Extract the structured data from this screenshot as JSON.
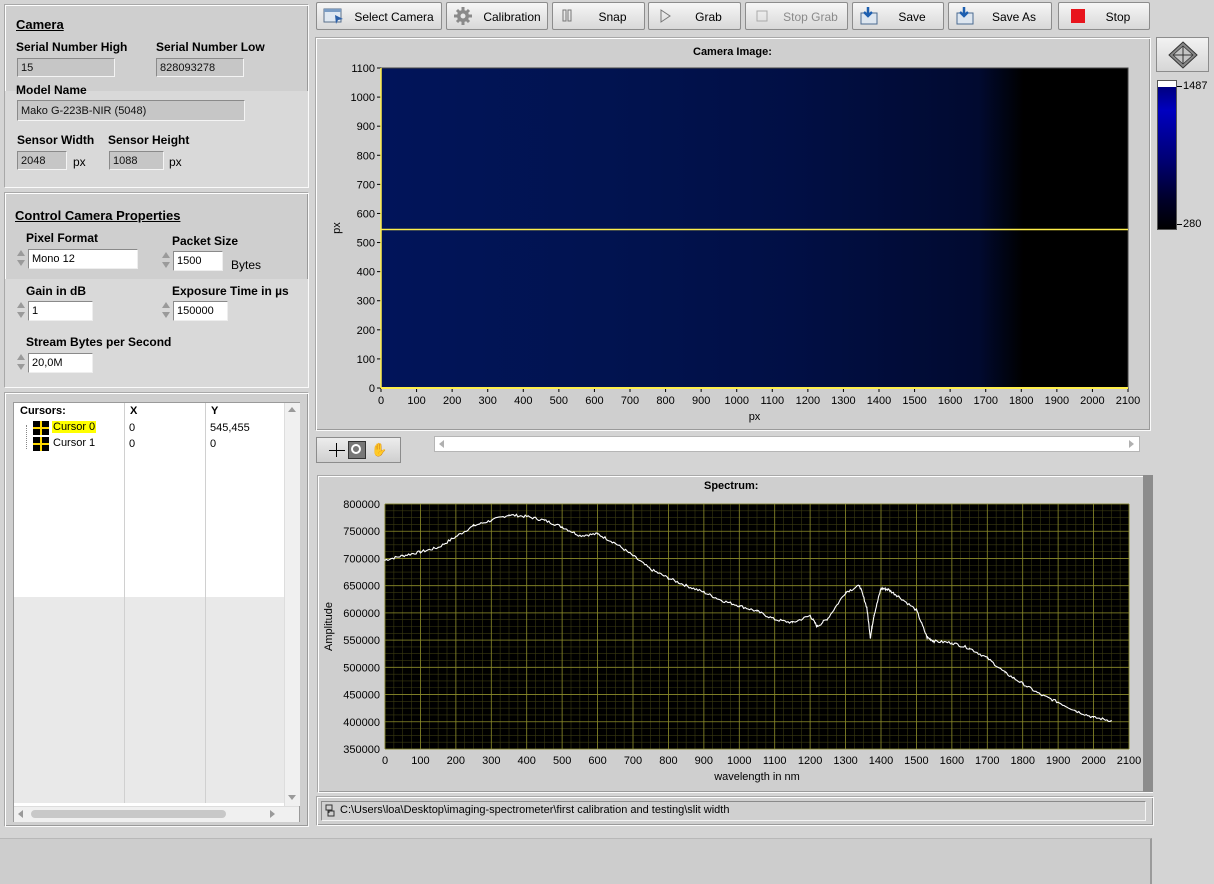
{
  "toolbar": {
    "select_camera": "Select Camera",
    "calibration": "Calibration",
    "snap": "Snap",
    "grab": "Grab",
    "stop_grab": "Stop Grab",
    "save": "Save",
    "save_as": "Save As",
    "stop": "Stop"
  },
  "camera": {
    "heading": "Camera",
    "serial_high_label": "Serial Number High",
    "serial_high": "15",
    "serial_low_label": "Serial Number Low",
    "serial_low": "828093278",
    "model_label": "Model Name",
    "model": "Mako G-223B-NIR (5048)",
    "width_label": "Sensor Width",
    "width": "2048",
    "height_label": "Sensor Height",
    "height": "1088",
    "unit_px": "px"
  },
  "control": {
    "heading": "Control Camera Properties",
    "pixel_format_label": "Pixel Format",
    "pixel_format": "Mono 12",
    "packet_size_label": "Packet Size",
    "packet_size": "1500",
    "bytes_unit": "Bytes",
    "gain_label": "Gain in dB",
    "gain": "1",
    "exposure_label": "Exposure Time in µs",
    "exposure": "150000",
    "stream_label": "Stream Bytes per Second",
    "stream": "20,0M"
  },
  "cursors": {
    "col_name": "Cursors:",
    "col_x": "X",
    "col_y": "Y",
    "rows": [
      {
        "name": "Cursor 0",
        "x": "0",
        "y": "545,455"
      },
      {
        "name": "Cursor 1",
        "x": "0",
        "y": "0"
      }
    ]
  },
  "image": {
    "title": "Camera Image:",
    "xlabel": "px",
    "ylabel": "px",
    "cursor_y": 545,
    "x_ticks": [
      "0",
      "100",
      "200",
      "300",
      "400",
      "500",
      "600",
      "700",
      "800",
      "900",
      "1000",
      "1100",
      "1200",
      "1300",
      "1400",
      "1500",
      "1600",
      "1700",
      "1800",
      "1900",
      "2000",
      "2100"
    ],
    "y_ticks": [
      "1100",
      "1000",
      "900",
      "800",
      "700",
      "600",
      "500",
      "400",
      "300",
      "200",
      "100",
      "0"
    ],
    "colorbar_max": "1487",
    "colorbar_min": "280"
  },
  "chart_data": {
    "type": "line",
    "title": "Spectrum:",
    "xlabel": "wavelength in nm",
    "ylabel": "Amplitude",
    "xlim": [
      0,
      2100
    ],
    "ylim": [
      350000,
      800000
    ],
    "x_ticks": [
      "0",
      "100",
      "200",
      "300",
      "400",
      "500",
      "600",
      "700",
      "800",
      "900",
      "1000",
      "1100",
      "1200",
      "1300",
      "1400",
      "1500",
      "1600",
      "1700",
      "1800",
      "1900",
      "2000",
      "2100"
    ],
    "y_ticks": [
      "800000",
      "750000",
      "700000",
      "650000",
      "600000",
      "550000",
      "500000",
      "450000",
      "400000",
      "350000"
    ],
    "series": [
      {
        "x": [
          0,
          50,
          100,
          150,
          200,
          250,
          300,
          350,
          400,
          450,
          500,
          550,
          600,
          650,
          700,
          750,
          800,
          850,
          900,
          950,
          1000,
          1050,
          1100,
          1150,
          1200,
          1220,
          1250,
          1300,
          1340,
          1360,
          1370,
          1380,
          1400,
          1420,
          1450,
          1500,
          1530,
          1550,
          1600,
          1650,
          1700,
          1750,
          1800,
          1850,
          1900,
          1950,
          2000,
          2050
        ],
        "values": [
          697000,
          705000,
          712000,
          720000,
          740000,
          760000,
          770000,
          780000,
          777000,
          770000,
          758000,
          742000,
          745000,
          728000,
          705000,
          680000,
          664000,
          650000,
          638000,
          623000,
          613000,
          603000,
          588000,
          582000,
          595000,
          575000,
          590000,
          638000,
          650000,
          610000,
          555000,
          595000,
          645000,
          643000,
          630000,
          605000,
          555000,
          548000,
          545000,
          535000,
          517000,
          490000,
          470000,
          450000,
          436000,
          420000,
          408000,
          402000
        ]
      }
    ]
  },
  "status": {
    "path": "C:\\Users\\loa\\Desktop\\imaging-spectrometer\\first calibration and testing\\slit width"
  }
}
